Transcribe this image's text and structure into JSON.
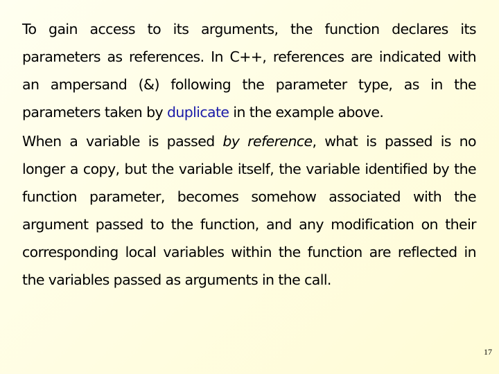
{
  "slide": {
    "paragraph_1": {
      "before_code": "To gain access to its arguments, the function declares its parameters as references. In C++, references are indicated with an ampersand (&) following the parameter type, as in the parameters taken by ",
      "code_ref": "duplicate",
      "after_code": " in the example above."
    },
    "paragraph_2": {
      "before_em": "When a variable is passed ",
      "emphasis": "by reference",
      "after_em": ", what is passed is no longer a copy, but the variable itself, the variable identified by the function parameter, becomes somehow associated with the argument passed to the function, and any modification on their corresponding local variables within the function are reflected in the variables passed as arguments in the call."
    },
    "page_number": "17",
    "colors": {
      "background": "#fffde2",
      "text": "#000000",
      "code_highlight": "#1a1aa8"
    }
  }
}
